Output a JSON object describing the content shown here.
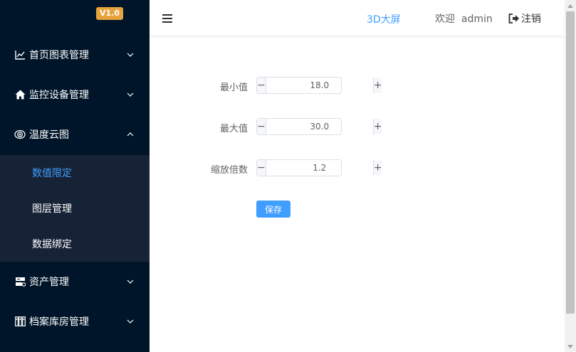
{
  "app": {
    "version": "V1.0",
    "accent_color": "#409eff",
    "sidebar_bg": "#001529",
    "submenu_bg": "#162336"
  },
  "sidebar": {
    "menu": [
      {
        "label": "首页图表管理",
        "icon": "line-chart-icon",
        "arrow": "chevron-down-icon"
      },
      {
        "label": "监控设备管理",
        "icon": "home-icon",
        "arrow": "chevron-down-icon"
      },
      {
        "label": "温度云图",
        "icon": "eye-icon",
        "arrow": "chevron-up-icon"
      },
      {
        "label": "资产管理",
        "icon": "server-icon",
        "arrow": "chevron-down-icon"
      },
      {
        "label": "档案库房管理",
        "icon": "archive-shelf-icon",
        "arrow": "chevron-down-icon"
      }
    ],
    "submenu": [
      {
        "label": "数值限定",
        "active": true
      },
      {
        "label": "图层管理",
        "active": false
      },
      {
        "label": "数据绑定",
        "active": false
      }
    ]
  },
  "header": {
    "menu_icon": "hamburger-icon",
    "screen_link": "3D大屏",
    "welcome": "欢迎  admin",
    "logout_icon": "sign-out-icon",
    "logout": "注销"
  },
  "form": {
    "min_label": "最小值",
    "min_value": "18.0",
    "max_label": "最大值",
    "max_value": "30.0",
    "scale_label": "缩放倍数",
    "scale_value": "1.2",
    "minus_symbol": "−",
    "plus_symbol": "+",
    "save_label": "保存"
  }
}
